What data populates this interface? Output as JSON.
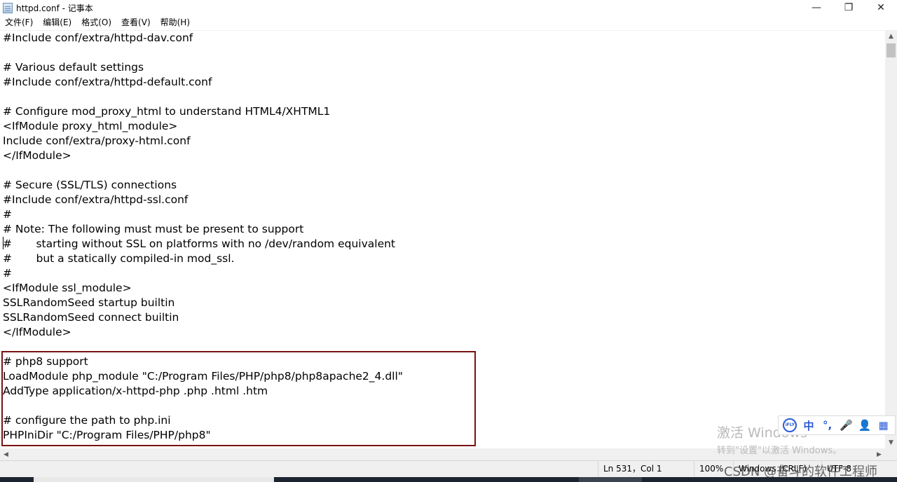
{
  "window": {
    "title": "httpd.conf - 记事本",
    "controls": {
      "minimize": "—",
      "restore": "❐",
      "close": "✕"
    }
  },
  "menu": [
    {
      "label": "文件(F)"
    },
    {
      "label": "编辑(E)"
    },
    {
      "label": "格式(O)"
    },
    {
      "label": "查看(V)"
    },
    {
      "label": "帮助(H)"
    }
  ],
  "editor": {
    "lines": [
      "#Include conf/extra/httpd-dav.conf",
      "",
      "# Various default settings",
      "#Include conf/extra/httpd-default.conf",
      "",
      "# Configure mod_proxy_html to understand HTML4/XHTML1",
      "<IfModule proxy_html_module>",
      "Include conf/extra/proxy-html.conf",
      "</IfModule>",
      "",
      "# Secure (SSL/TLS) connections",
      "#Include conf/extra/httpd-ssl.conf",
      "#",
      "# Note: The following must must be present to support",
      "#       starting without SSL on platforms with no /dev/random equivalent",
      "#       but a statically compiled-in mod_ssl.",
      "#",
      "<IfModule ssl_module>",
      "SSLRandomSeed startup builtin",
      "SSLRandomSeed connect builtin",
      "</IfModule>",
      "",
      "# php8 support",
      "LoadModule php_module \"C:/Program Files/PHP/php8/php8apache2_4.dll\"",
      "AddType application/x-httpd-php .php .html .htm",
      "",
      "# configure the path to php.ini",
      "PHPIniDir \"C:/Program Files/PHP/php8\""
    ],
    "highlight_color": "#7a1212"
  },
  "scrollbars": {
    "up_arrow": "▲",
    "down_arrow": "▼",
    "left_arrow": "◀",
    "right_arrow": "▶"
  },
  "status": {
    "position": "Ln 531，Col 1",
    "zoom": "100%",
    "line_ending": "Windows (CRLF)",
    "encoding": "UTF-8"
  },
  "watermark": {
    "line1": "激活 Windows",
    "line2": "转到\"设置\"以激活 Windows。"
  },
  "ime": {
    "logo": "iFLY",
    "mode": "中",
    "punct": "°,",
    "mic_icon": "🎤",
    "user_icon": "👤",
    "grid_icon": "▦"
  },
  "csdn": "CSDN @奋斗的软件工程师"
}
